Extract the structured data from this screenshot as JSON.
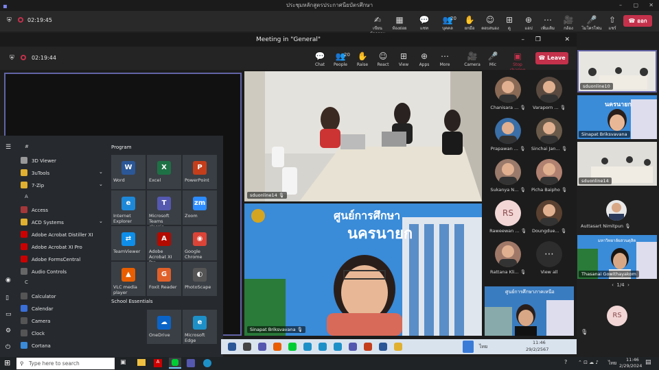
{
  "window": {
    "title": "ประชุมหลักสูตรประกาศนียบัตรศึกษา"
  },
  "outer": {
    "timer": "02:19:45",
    "tools": [
      {
        "icon": "✍",
        "label": "เขียนข้อความ"
      },
      {
        "icon": "▦",
        "label": "ห้องย่อย"
      },
      {
        "icon": "💬",
        "label": "แชท"
      },
      {
        "icon": "👥",
        "label": "บุคคล",
        "count": "20"
      },
      {
        "icon": "✋",
        "label": "ยกมือ"
      },
      {
        "icon": "☺",
        "label": "ตอบสนอง"
      },
      {
        "icon": "⊞",
        "label": "ดู"
      },
      {
        "icon": "⊕",
        "label": "แอป"
      },
      {
        "icon": "⋯",
        "label": "เพิ่มเติม"
      },
      {
        "icon": "🎥",
        "label": "กล้อง"
      },
      {
        "icon": "🎤",
        "label": "ไมโครโฟน"
      },
      {
        "icon": "⇧",
        "label": "แชร์"
      }
    ],
    "leave_label": "ออก"
  },
  "meeting": {
    "title": "Meeting in \"General\"",
    "timer": "02:19:44",
    "tools": [
      {
        "icon": "💬",
        "label": "Chat"
      },
      {
        "icon": "👥",
        "label": "People",
        "count": "20"
      },
      {
        "icon": "✋",
        "label": "Raise"
      },
      {
        "icon": "☺",
        "label": "React"
      },
      {
        "icon": "⊞",
        "label": "View"
      },
      {
        "icon": "⊕",
        "label": "Apps"
      },
      {
        "icon": "⋯",
        "label": "More"
      },
      {
        "icon": "🎥",
        "label": "Camera"
      },
      {
        "icon": "🎤",
        "label": "Mic"
      },
      {
        "icon": "▣",
        "label": "Stop sharing"
      }
    ],
    "leave_label": "Leave"
  },
  "stage": {
    "tile1_name": "sduonline14",
    "tile2_name": "Sinapat Briksvavana",
    "banner_small": "ศูนย์การศึกษา",
    "banner_big": "นครนายก"
  },
  "participants": [
    {
      "name": "Chanisara ...",
      "initials": "",
      "color": "#8a6a55"
    },
    {
      "name": "Varaporn ...",
      "initials": "",
      "color": "#5a4a40"
    },
    {
      "name": "Prapawan ...",
      "initials": "",
      "color": "#3a6fa8"
    },
    {
      "name": "Sinchai Jan...",
      "initials": "",
      "color": "#6a5a4a"
    },
    {
      "name": "Sukanya N...",
      "initials": "",
      "color": "#9a7a6a"
    },
    {
      "name": "Picha Baipho",
      "initials": "",
      "color": "#b08070"
    },
    {
      "name": "Raweewan ...",
      "initials": "RS",
      "color": "#f2d6d6"
    },
    {
      "name": "Doungdue...",
      "initials": "",
      "color": "#5a4030"
    },
    {
      "name": "Rattana Kli...",
      "initials": "",
      "color": "#a07868"
    },
    {
      "name": "View all",
      "initials": "⋯",
      "color": "#2d2d2d"
    }
  ],
  "bottom_tile_label": "ศูนย์การศึกษาภาคเหนือ",
  "right": {
    "t1": "sduonline10",
    "t2": "Sinapat Briksvavana",
    "t3": "sduonline14",
    "t4": "Auttasart Nimitpun",
    "t5": "Thasanai Gowithayakom",
    "t4_banner": "มหาวิทยาลัยสวนดุสิต",
    "page": "1/4",
    "rs": "RS",
    "t2_banner": "นครนายก"
  },
  "start": {
    "section_hash": "#",
    "section_a": "A",
    "section_c": "C",
    "program_label": "Program",
    "school_label": "School Essentials",
    "apps": [
      "3D Viewer",
      "3uTools",
      "7-Zip",
      "Access",
      "ACD Systems",
      "Adobe Acrobat Distiller XI",
      "Adobe Acrobat XI Pro",
      "Adobe FormsCentral",
      "Audio Controls",
      "Calculator",
      "Calendar",
      "Camera",
      "Clock",
      "Cortana"
    ],
    "pins": [
      {
        "label": "Word",
        "glyph": "W",
        "color": "#2b5797"
      },
      {
        "label": "Excel",
        "glyph": "X",
        "color": "#1e7145"
      },
      {
        "label": "PowerPoint",
        "glyph": "P",
        "color": "#c43e1c"
      },
      {
        "label": "Internet Explorer",
        "glyph": "e",
        "color": "#1e88d8"
      },
      {
        "label": "Microsoft Teams classic",
        "glyph": "T",
        "color": "#5558af"
      },
      {
        "label": "Zoom",
        "glyph": "zm",
        "color": "#2d8cff"
      },
      {
        "label": "TeamViewer",
        "glyph": "⇄",
        "color": "#0e8ee9"
      },
      {
        "label": "Adobe Acrobat XI Pro",
        "glyph": "A",
        "color": "#b30b00"
      },
      {
        "label": "Google Chrome",
        "glyph": "◉",
        "color": "#db4437"
      },
      {
        "label": "VLC media player",
        "glyph": "▲",
        "color": "#e85e00"
      },
      {
        "label": "Foxit Reader",
        "glyph": "G",
        "color": "#e0602a"
      },
      {
        "label": "PhotoScape",
        "glyph": "◐",
        "color": "#555"
      }
    ],
    "school": [
      {
        "label": "OneDrive",
        "glyph": "☁",
        "color": "#0a64c8"
      },
      {
        "label": "Microsoft Edge",
        "glyph": "e",
        "color": "#1e90c8"
      }
    ]
  },
  "inner_taskbar": {
    "time": "11:46",
    "date": "29/2/2567",
    "lang": "ไทย"
  },
  "taskbar": {
    "search_placeholder": "Type here to search",
    "time": "11:46",
    "date": "2/29/2024",
    "lang": "ไทย"
  }
}
